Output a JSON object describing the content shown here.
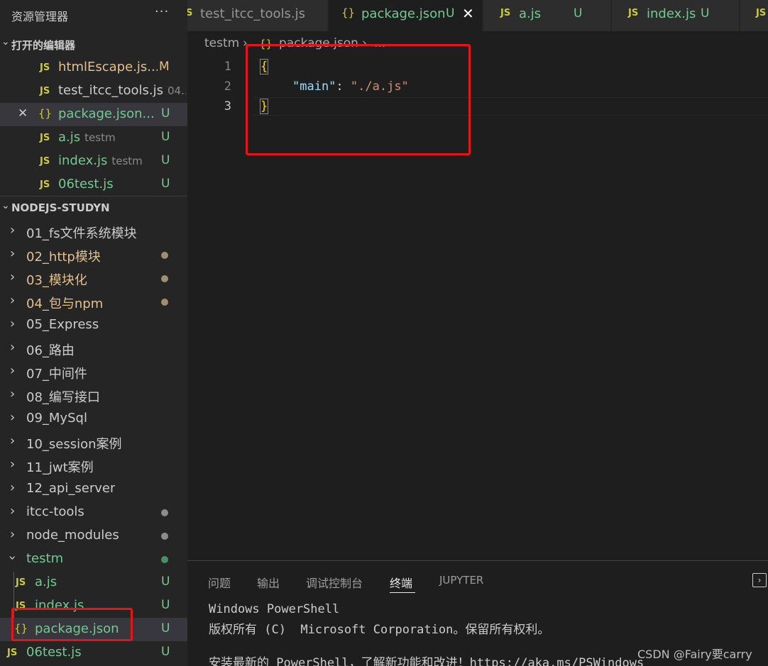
{
  "sidebar": {
    "title": "资源管理器",
    "more": "···",
    "open_editors": {
      "title": "打开的编辑器",
      "items": [
        {
          "icon": "JS",
          "name": "htmlEscape.js...",
          "badge": "M"
        },
        {
          "icon": "JS",
          "name": "test_itcc_tools.js",
          "desc": "04..."
        },
        {
          "icon": "{}",
          "name": "package.json...",
          "badge": "U"
        },
        {
          "icon": "JS",
          "name": "a.js",
          "desc": "testm",
          "badge": "U"
        },
        {
          "icon": "JS",
          "name": "index.js",
          "desc": "testm",
          "badge": "U"
        },
        {
          "icon": "JS",
          "name": "06test.js",
          "badge": "U"
        }
      ]
    },
    "workspace": {
      "title": "NODEJS-STUDYN",
      "folders": [
        "01_fs文件系统模块",
        "02_http模块",
        "03_模块化",
        "04_包与npm",
        "05_Express",
        "06_路由",
        "07_中间件",
        "08_编写接口",
        "09_MySql",
        "10_session案例",
        "11_jwt案例",
        "12_api_server",
        "itcc-tools",
        "node_modules",
        "testm"
      ],
      "testm_files": [
        {
          "icon": "JS",
          "name": "a.js",
          "badge": "U"
        },
        {
          "icon": "JS",
          "name": "index.js",
          "badge": "U"
        },
        {
          "icon": "{}",
          "name": "package.json",
          "badge": "U"
        }
      ],
      "root_file": {
        "icon": "JS",
        "name": "06test.js",
        "badge": "U"
      }
    }
  },
  "tabs": [
    {
      "icon": "JS",
      "label": "test_itcc_tools.js"
    },
    {
      "icon": "{}",
      "label": "package.json",
      "badge": "U",
      "close": "✕"
    },
    {
      "icon": "JS",
      "label": "a.js",
      "badge": "U"
    },
    {
      "icon": "JS",
      "label": "index.js",
      "badge": "U"
    },
    {
      "icon": "JS",
      "label": ""
    }
  ],
  "breadcrumb": {
    "folder": "testm",
    "sep": "›",
    "file_icon": "{}",
    "file": "package.json",
    "rest": "..."
  },
  "editor": {
    "line_numbers": [
      "1",
      "2",
      "3"
    ],
    "lines": {
      "l1_brace": "{",
      "l2_key": "\"main\"",
      "l2_colon": ": ",
      "l2_value": "\"./a.js\"",
      "l3_brace": "}"
    }
  },
  "panel": {
    "tabs": [
      "问题",
      "输出",
      "调试控制台",
      "终端",
      "JUPYTER"
    ],
    "maximize": "›",
    "terminal_lines": [
      "Windows PowerShell",
      "版权所有 (C)  Microsoft Corporation。保留所有权利。",
      "",
      "安装最新的 PowerShell，了解新功能和改进！https://aka.ms/PSWindows"
    ]
  },
  "watermark": "CSDN @Fairy要carry",
  "colors": {
    "annotation_red": "#e4141b",
    "untracked_green": "#73c991",
    "modified_orange": "#e2c08d",
    "js_icon_yellow": "#cbcb41"
  }
}
